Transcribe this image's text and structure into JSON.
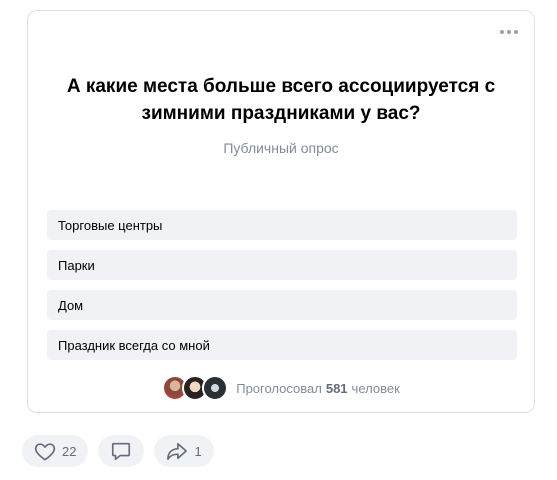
{
  "poll": {
    "title": "А какие места больше всего ассоциируется с зимними праздниками у вас?",
    "subtitle": "Публичный опрос",
    "options": [
      {
        "label": "Торговые центры"
      },
      {
        "label": "Парки"
      },
      {
        "label": "Дом"
      },
      {
        "label": "Праздник всегда со мной"
      }
    ],
    "voters": {
      "prefix": "Проголосовал",
      "count": "581",
      "suffix": "человек"
    }
  },
  "actions": {
    "likes": "22",
    "shares": "1"
  },
  "icons": [
    "more-icon",
    "heart-icon",
    "comment-icon",
    "share-icon"
  ],
  "colors": {
    "option_bg": "#f0f2f5",
    "muted_text": "#818c99",
    "border": "#dce1e6"
  }
}
